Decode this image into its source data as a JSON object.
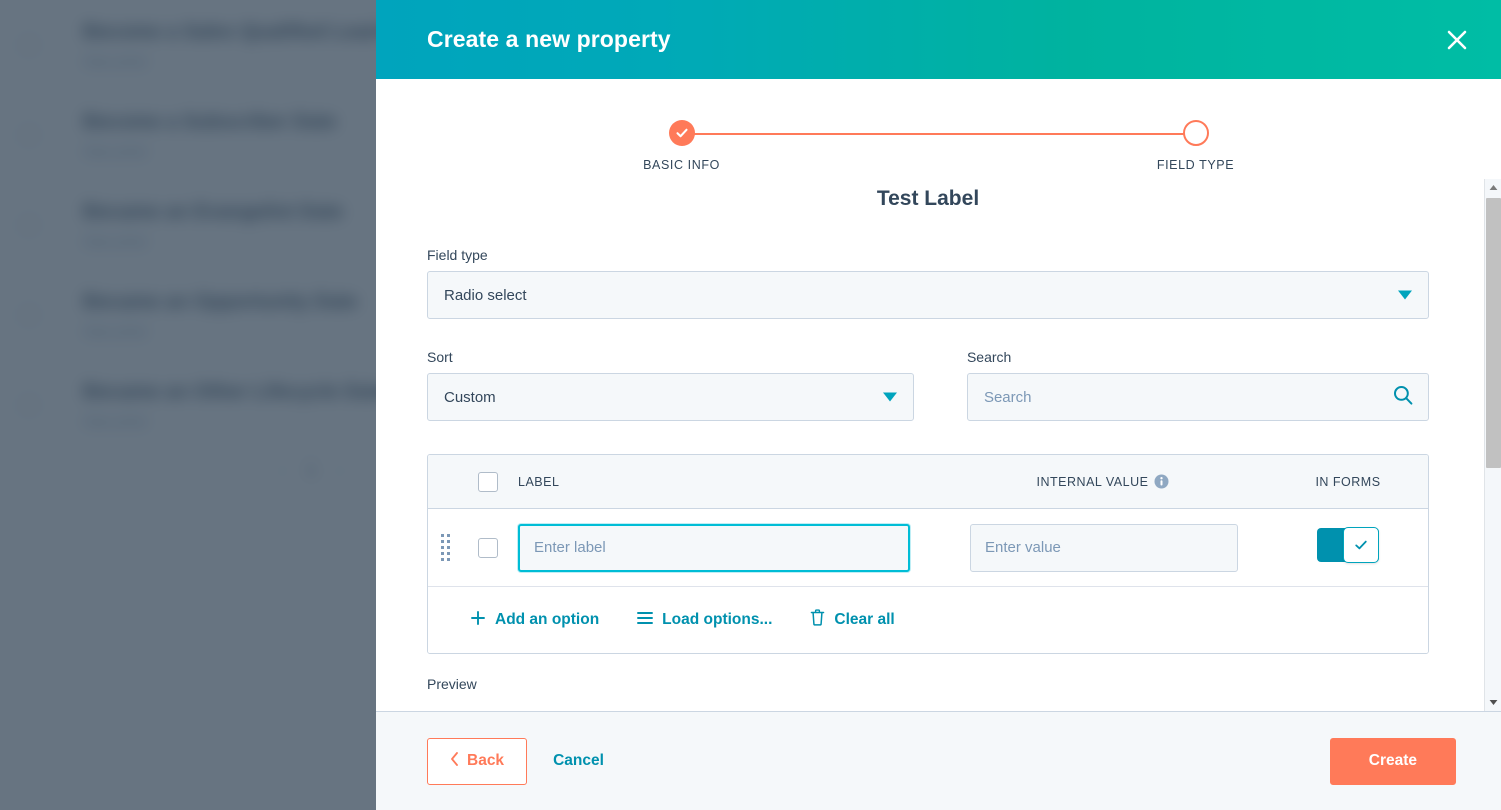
{
  "background": {
    "rows": [
      {
        "title": "Become a Sales Qualified Lead Date",
        "sub": "Date picker"
      },
      {
        "title": "Become a Subscriber Date",
        "sub": "Date picker"
      },
      {
        "title": "Became an Evangelist Date",
        "sub": "Date picker"
      },
      {
        "title": "Became an Opportunity Date",
        "sub": "Date picker"
      },
      {
        "title": "Became an Other Lifecycle Date",
        "sub": "Date picker"
      }
    ],
    "pager": {
      "prev_icon": "chevron-left-icon",
      "page": "1",
      "next_icon": "chevron-right-icon"
    }
  },
  "modal": {
    "title": "Create a new property",
    "close_icon": "close-icon",
    "stepper": {
      "steps": [
        {
          "label": "BASIC INFO",
          "state": "done",
          "icon": "check-icon"
        },
        {
          "label": "FIELD TYPE",
          "state": "current",
          "icon": "circle-icon"
        }
      ],
      "accent_color": "#ff7a59"
    },
    "form": {
      "heading": "Test Label",
      "field_type": {
        "label": "Field type",
        "value": "Radio select",
        "caret_icon": "chevron-down-icon"
      },
      "sort": {
        "label": "Sort",
        "value": "Custom",
        "caret_icon": "chevron-down-icon"
      },
      "search": {
        "label": "Search",
        "placeholder": "Search",
        "value": "",
        "icon": "search-icon"
      },
      "preview_label": "Preview"
    },
    "options_table": {
      "headers": {
        "label": "LABEL",
        "internal_value": "INTERNAL VALUE",
        "internal_value_info_icon": "info-icon",
        "in_forms": "IN FORMS"
      },
      "rows": [
        {
          "drag_icon": "drag-handle-icon",
          "selected": false,
          "label_placeholder": "Enter label",
          "label_value": "",
          "value_placeholder": "Enter value",
          "value_value": "",
          "in_forms": true,
          "in_forms_icon": "check-icon"
        }
      ],
      "actions": [
        {
          "label": "Add an option",
          "icon": "plus-icon"
        },
        {
          "label": "Load options...",
          "icon": "list-icon"
        },
        {
          "label": "Clear all",
          "icon": "trash-icon"
        }
      ]
    },
    "footer": {
      "back_label": "Back",
      "back_icon": "chevron-left-icon",
      "cancel_label": "Cancel",
      "create_label": "Create"
    },
    "scrollbar": {
      "up_icon": "caret-up-icon",
      "down_icon": "caret-down-icon"
    }
  },
  "colors": {
    "header_gradient_start": "#00a4bd",
    "header_gradient_end": "#00bda5",
    "accent_orange": "#ff7a59",
    "link_blue": "#0091ae",
    "toggle_on": "#0091ae",
    "focus_cyan": "#00bdd6",
    "text_dark": "#33475b"
  }
}
